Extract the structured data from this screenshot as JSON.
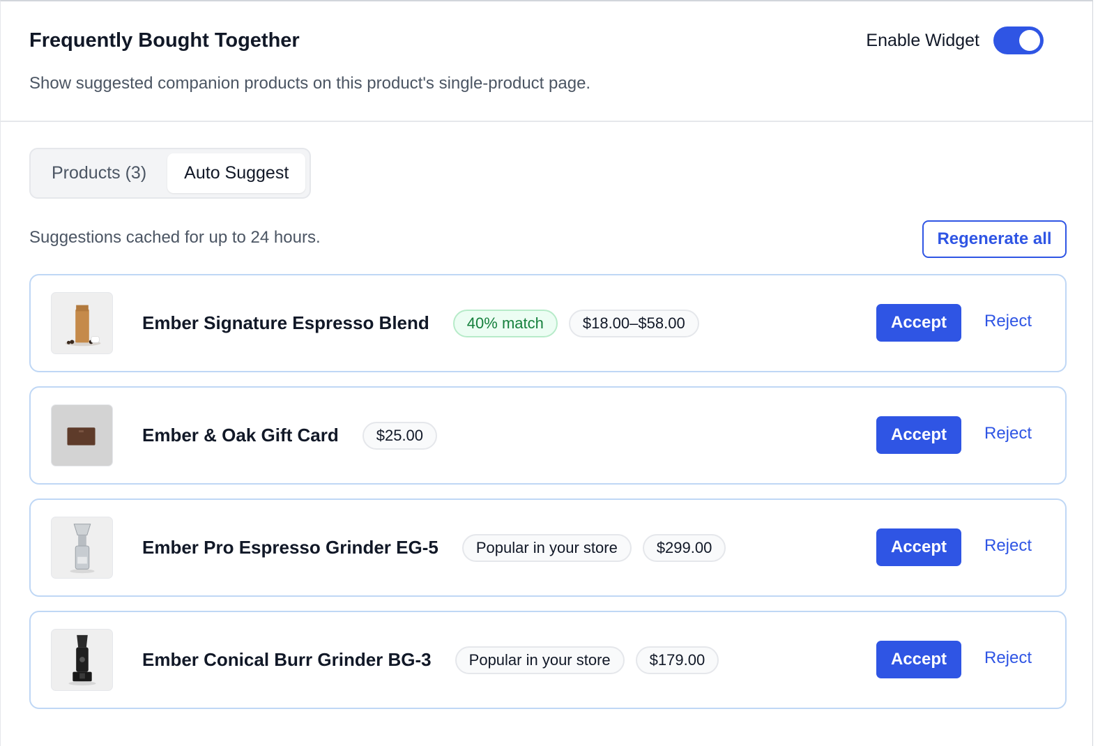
{
  "header": {
    "title": "Frequently Bought Together",
    "subtitle": "Show suggested companion products on this product's single-product page.",
    "toggle_label": "Enable Widget",
    "toggle_on": true
  },
  "tabs": [
    {
      "label": "Products (3)",
      "active": false
    },
    {
      "label": "Auto Suggest",
      "active": true
    }
  ],
  "cache_note": "Suggestions cached for up to 24 hours.",
  "regenerate_label": "Regenerate all",
  "suggestions": [
    {
      "name": "Ember Signature Espresso Blend",
      "badges": [
        "40% match",
        "$18.00–$58.00"
      ],
      "accept": "Accept",
      "reject": "Reject",
      "thumb_icon": "coffee-bag-icon"
    },
    {
      "name": "Ember & Oak Gift Card",
      "badges": [
        "$25.00"
      ],
      "accept": "Accept",
      "reject": "Reject",
      "thumb_icon": "gift-card-icon"
    },
    {
      "name": "Ember Pro Espresso Grinder EG-5",
      "badges": [
        "Popular in your store",
        "$299.00"
      ],
      "accept": "Accept",
      "reject": "Reject",
      "thumb_icon": "grinder-icon"
    },
    {
      "name": "Ember Conical Burr Grinder BG-3",
      "badges": [
        "Popular in your store",
        "$179.00"
      ],
      "accept": "Accept",
      "reject": "Reject",
      "thumb_icon": "burr-grinder-icon"
    }
  ],
  "colors": {
    "accent": "#2f55e4",
    "match_text": "#16803d",
    "card_border": "#bfd7f5"
  }
}
